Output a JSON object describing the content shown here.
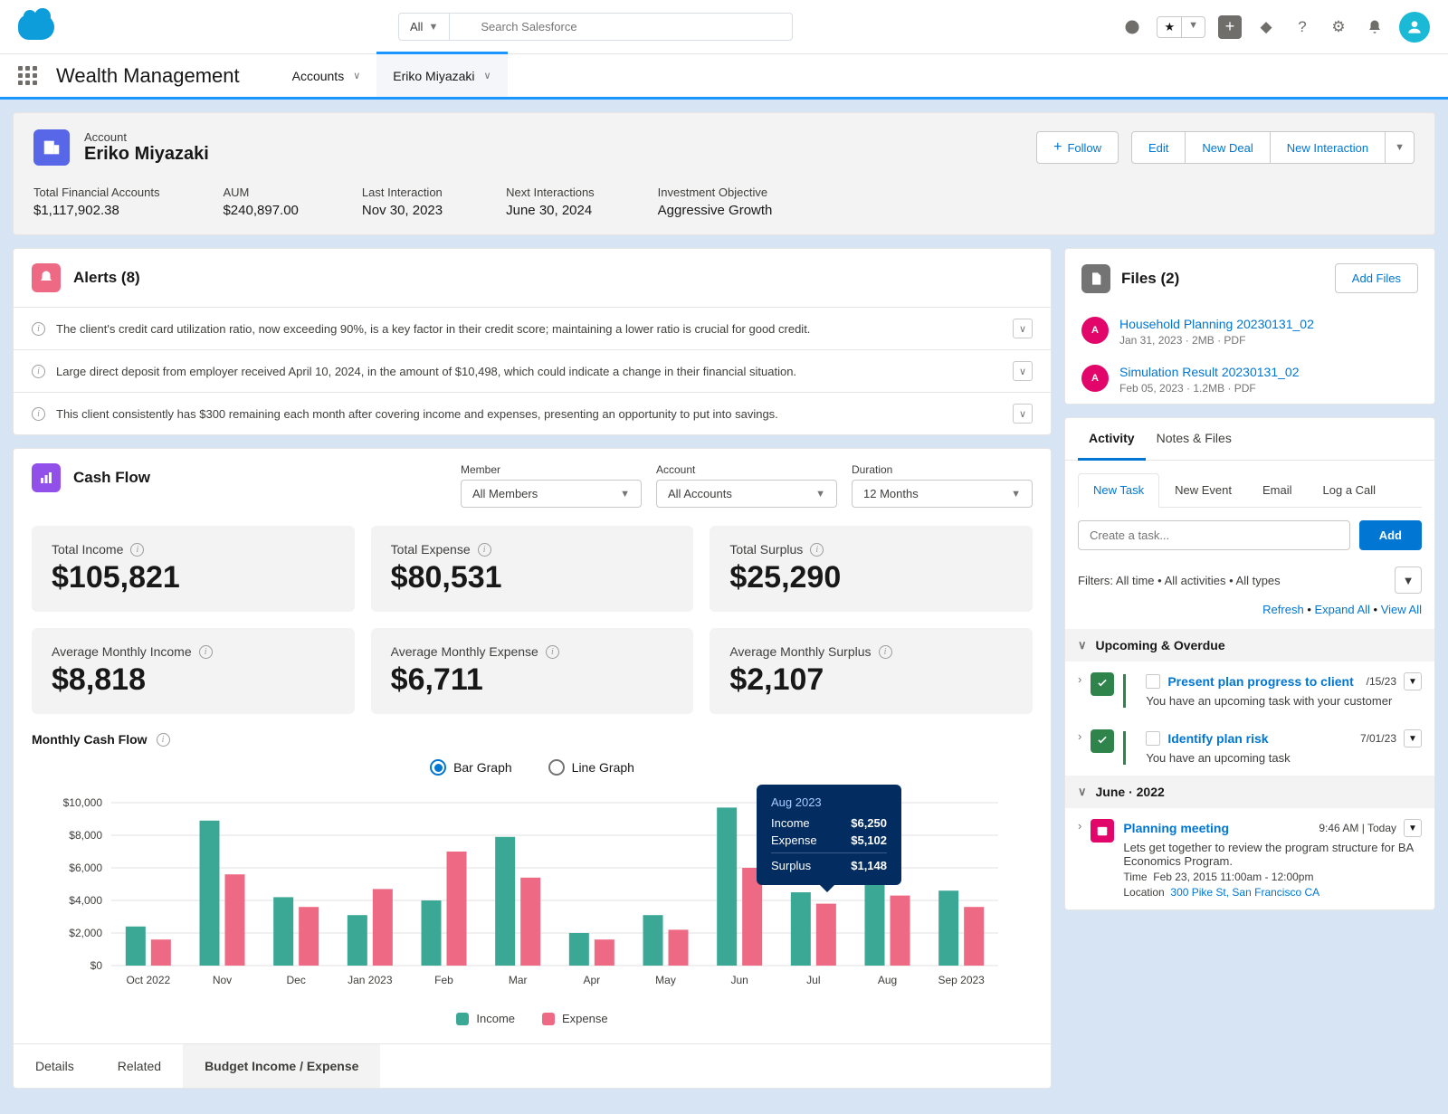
{
  "search": {
    "scope": "All",
    "placeholder": "Search Salesforce"
  },
  "app_name": "Wealth Management",
  "nav": {
    "accounts": "Accounts",
    "current": "Eriko Miyazaki"
  },
  "record": {
    "type": "Account",
    "name": "Eriko Miyazaki",
    "actions": {
      "follow": "Follow",
      "edit": "Edit",
      "new_deal": "New Deal",
      "new_interaction": "New Interaction"
    },
    "fields": [
      {
        "label": "Total Financial Accounts",
        "value": "$1,117,902.38"
      },
      {
        "label": "AUM",
        "value": "$240,897.00"
      },
      {
        "label": "Last Interaction",
        "value": "Nov 30, 2023"
      },
      {
        "label": "Next Interactions",
        "value": "June 30, 2024"
      },
      {
        "label": "Investment Objective",
        "value": "Aggressive Growth"
      }
    ]
  },
  "alerts": {
    "title": "Alerts (8)",
    "items": [
      "The client's credit card utilization ratio, now exceeding 90%, is a key factor in their credit score; maintaining a lower ratio is crucial for good credit.",
      "Large direct deposit from employer received April 10, 2024, in the amount of $10,498, which could indicate a change in their financial situation.",
      "This client consistently has $300 remaining each month after covering income and expenses, presenting an opportunity to put into savings."
    ]
  },
  "cashflow": {
    "title": "Cash Flow",
    "filters": {
      "member": {
        "label": "Member",
        "value": "All Members"
      },
      "account": {
        "label": "Account",
        "value": "All Accounts"
      },
      "duration": {
        "label": "Duration",
        "value": "12 Months"
      }
    },
    "metrics": {
      "total_income": {
        "label": "Total Income",
        "value": "$105,821"
      },
      "total_expense": {
        "label": "Total Expense",
        "value": "$80,531"
      },
      "total_surplus": {
        "label": "Total Surplus",
        "value": "$25,290"
      },
      "avg_income": {
        "label": "Average Monthly Income",
        "value": "$8,818"
      },
      "avg_expense": {
        "label": "Average Monthly Expense",
        "value": "$6,711"
      },
      "avg_surplus": {
        "label": "Average Monthly Surplus",
        "value": "$2,107"
      }
    },
    "chart_title": "Monthly Cash Flow",
    "toggle": {
      "bar": "Bar Graph",
      "line": "Line Graph"
    },
    "legend": {
      "income": "Income",
      "expense": "Expense"
    },
    "tooltip": {
      "title": "Aug 2023",
      "income_l": "Income",
      "income": "$6,250",
      "expense_l": "Expense",
      "expense": "$5,102",
      "surplus_l": "Surplus",
      "surplus": "$1,148"
    },
    "tabs": {
      "details": "Details",
      "related": "Related",
      "budget": "Budget Income / Expense"
    }
  },
  "chart_data": {
    "type": "bar",
    "categories": [
      "Oct 2022",
      "Nov",
      "Dec",
      "Jan 2023",
      "Feb",
      "Mar",
      "Apr",
      "May",
      "Jun",
      "Jul",
      "Aug",
      "Sep 2023"
    ],
    "series": [
      {
        "name": "Income",
        "values": [
          2400,
          8900,
          4200,
          3100,
          4000,
          7900,
          2000,
          3100,
          9700,
          4500,
          5000,
          4600
        ]
      },
      {
        "name": "Expense",
        "values": [
          1600,
          5600,
          3600,
          4700,
          7000,
          5400,
          1600,
          2200,
          6000,
          3800,
          4300,
          3600
        ]
      }
    ],
    "ylabel": "",
    "xlabel": "",
    "ylim": [
      0,
      10000
    ],
    "yticks": [
      "$0",
      "$2,000",
      "$4,000",
      "$6,000",
      "$8,000",
      "$10,000"
    ]
  },
  "files": {
    "title": "Files (2)",
    "add": "Add Files",
    "items": [
      {
        "name": "Household Planning 20230131_02",
        "meta": "Jan 31, 2023 · 2MB · PDF"
      },
      {
        "name": "Simulation Result 20230131_02",
        "meta": "Feb 05, 2023 · 1.2MB · PDF"
      }
    ]
  },
  "activity": {
    "tabs": {
      "activity": "Activity",
      "notes": "Notes & Files"
    },
    "sub_tabs": {
      "new_task": "New Task",
      "new_event": "New Event",
      "email": "Email",
      "log_call": "Log a Call"
    },
    "create_placeholder": "Create a task...",
    "add": "Add",
    "filters_text": "Filters: All time • All activities • All types",
    "links": {
      "refresh": "Refresh",
      "expand": "Expand All",
      "view": "View All"
    },
    "upcoming": "Upcoming & Overdue",
    "tasks": [
      {
        "title": "Present plan progress to client",
        "date": "/15/23",
        "desc": "You have an upcoming task with your customer"
      },
      {
        "title": "Identify plan risk",
        "date": "7/01/23",
        "desc": "You have an upcoming task"
      }
    ],
    "past_section": "June · 2022",
    "event": {
      "title": "Planning meeting",
      "time_meta": "9:46 AM | Today",
      "desc": "Lets get together to review the program structure for BA Economics Program.",
      "time_label": "Time",
      "time": "Feb 23, 2015  11:00am - 12:00pm",
      "loc_label": "Location",
      "location": "300 Pike St, San Francisco CA"
    }
  }
}
